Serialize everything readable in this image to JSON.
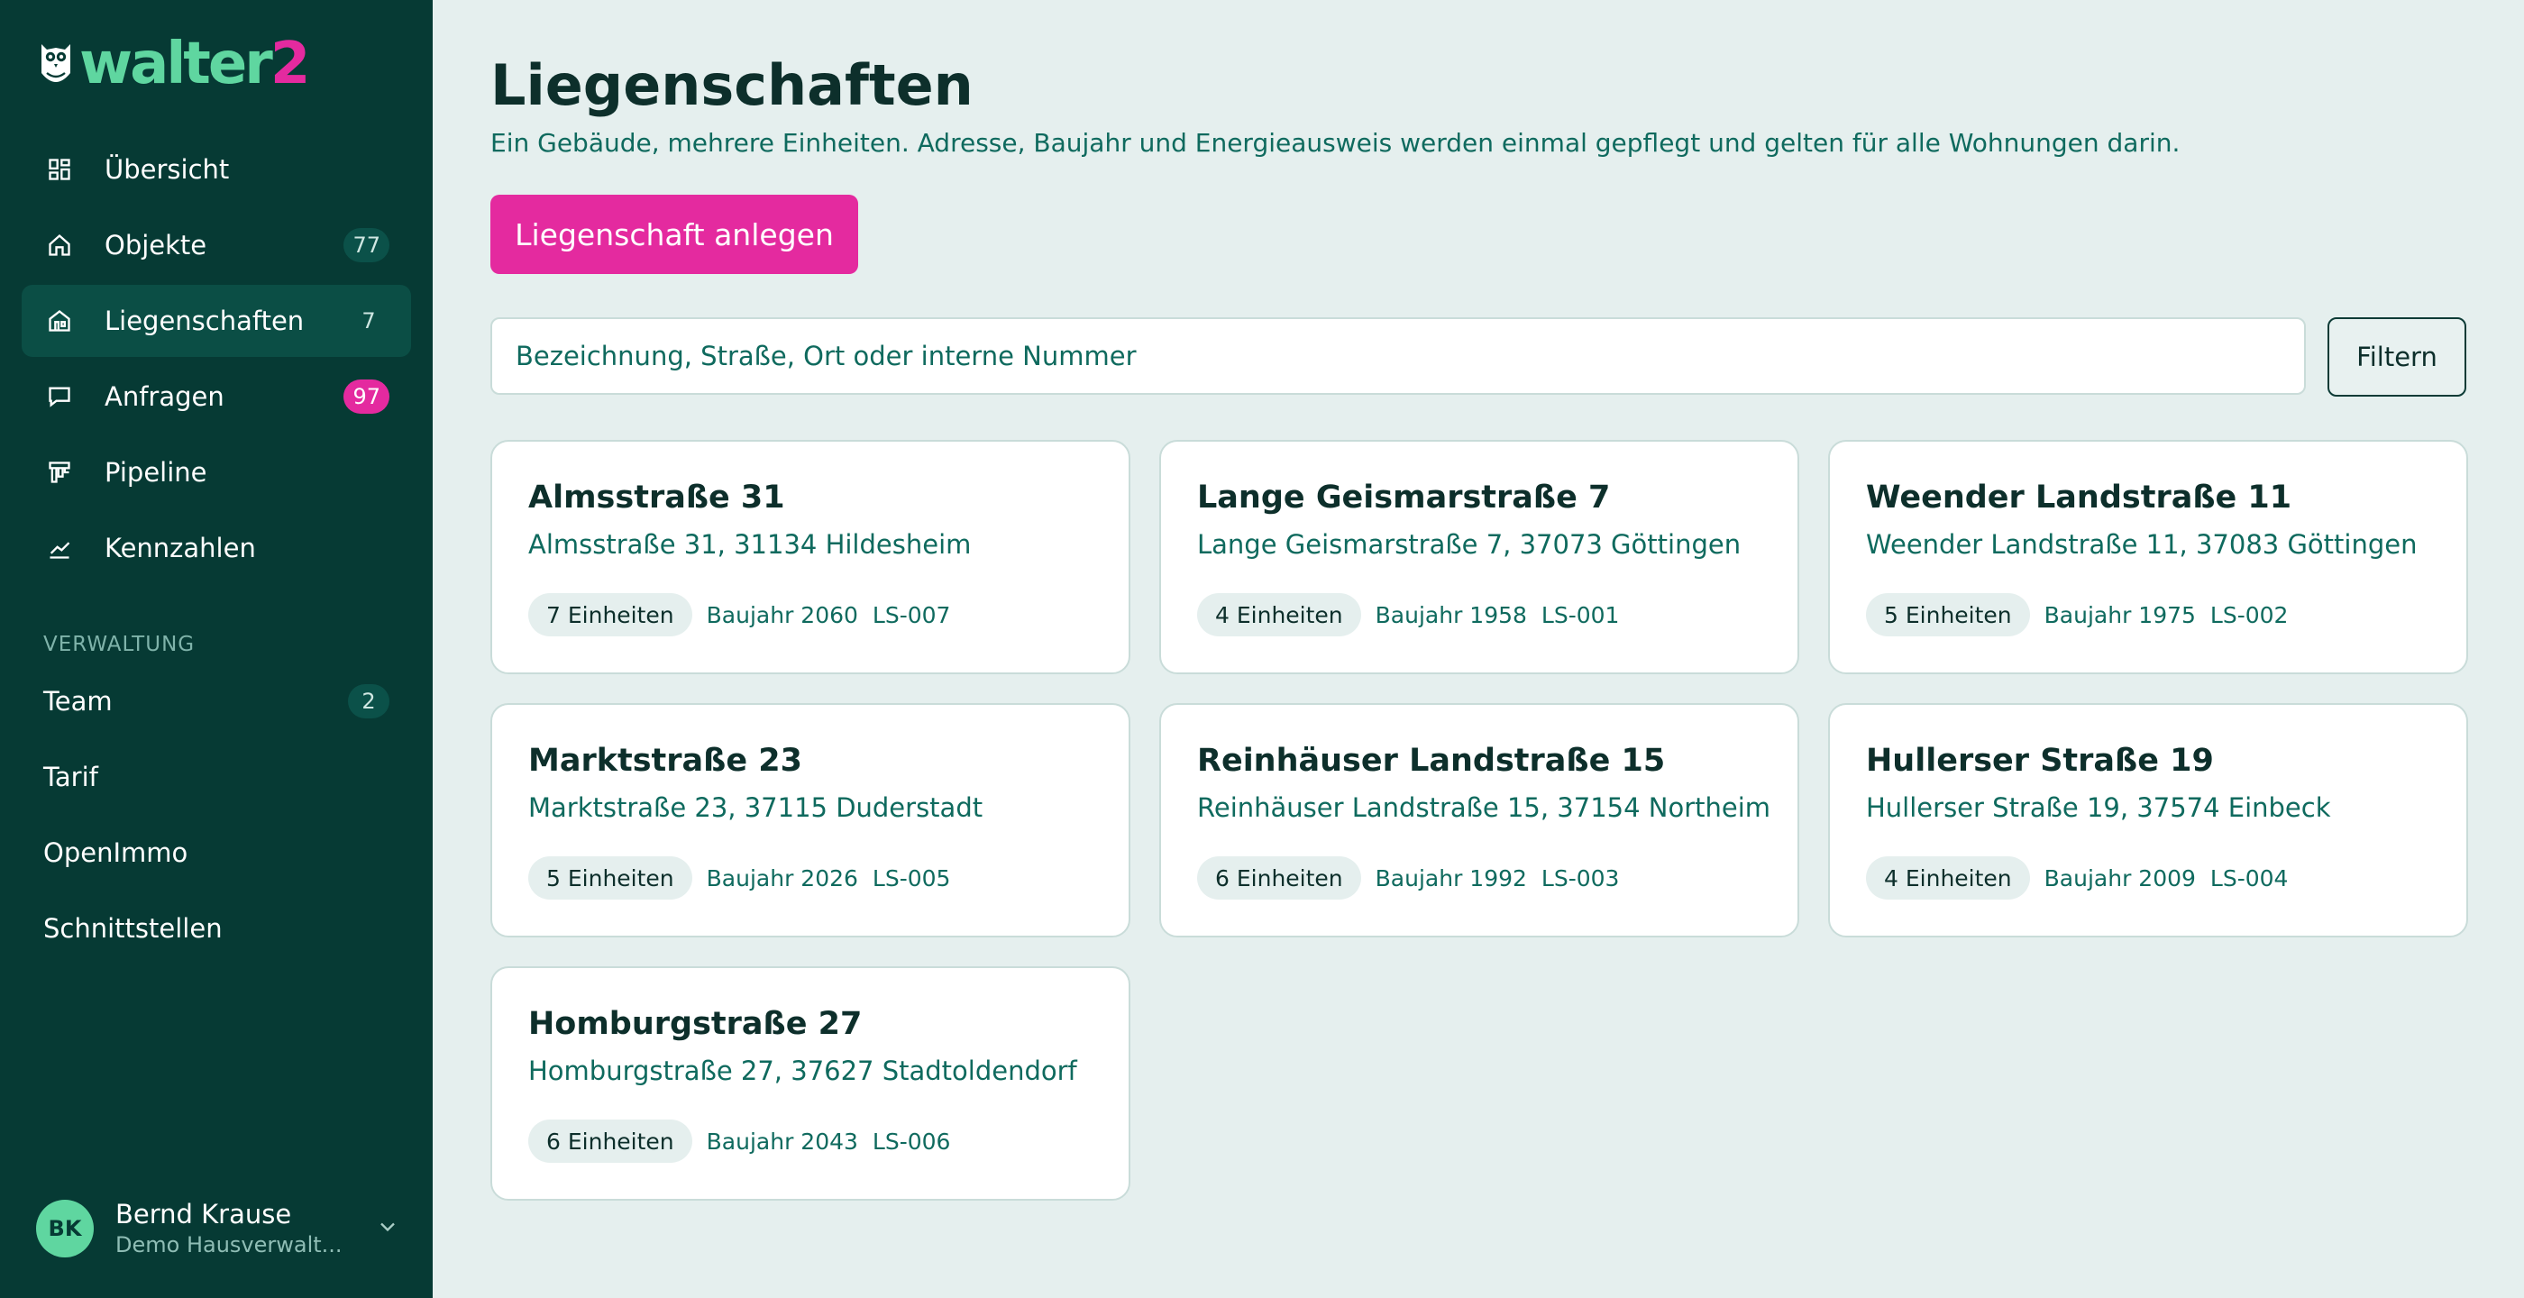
{
  "brand": {
    "name_main": "walter",
    "name_accent": "2"
  },
  "sidebar": {
    "items": [
      {
        "label": "Übersicht",
        "icon": "dashboard-icon",
        "badge": null
      },
      {
        "label": "Objekte",
        "icon": "home-icon",
        "badge": "77"
      },
      {
        "label": "Liegenschaften",
        "icon": "building-icon",
        "badge": "7",
        "active": true
      },
      {
        "label": "Anfragen",
        "icon": "chat-icon",
        "badge": "97"
      },
      {
        "label": "Pipeline",
        "icon": "pipeline-icon",
        "badge": null
      },
      {
        "label": "Kennzahlen",
        "icon": "chart-icon",
        "badge": null
      }
    ],
    "section_title": "VERWALTUNG",
    "admin_items": [
      {
        "label": "Team",
        "badge": "2"
      },
      {
        "label": "Tarif"
      },
      {
        "label": "OpenImmo"
      },
      {
        "label": "Schnittstellen"
      }
    ]
  },
  "user": {
    "initials": "BK",
    "name": "Bernd Krause",
    "org": "Demo Hausverwalt..."
  },
  "main": {
    "title": "Liegenschaften",
    "subtitle": "Ein Gebäude, mehrere Einheiten. Adresse, Baujahr und Energieausweis werden einmal gepflegt und gelten für alle Wohnungen darin.",
    "create_button": "Liegenschaft anlegen",
    "search_placeholder": "Bezeichnung, Straße, Ort oder interne Nummer",
    "filter_button": "Filtern",
    "cards": [
      {
        "title": "Almsstraße 31",
        "address": "Almsstraße 31, 31134 Hildesheim",
        "units": "7 Einheiten",
        "year": "Baujahr 2060",
        "code": "LS-007"
      },
      {
        "title": "Lange Geismarstraße 7",
        "address": "Lange Geismarstraße 7, 37073 Göttingen",
        "units": "4 Einheiten",
        "year": "Baujahr 1958",
        "code": "LS-001"
      },
      {
        "title": "Weender Landstraße 11",
        "address": "Weender Landstraße 11, 37083 Göttingen",
        "units": "5 Einheiten",
        "year": "Baujahr 1975",
        "code": "LS-002"
      },
      {
        "title": "Marktstraße 23",
        "address": "Marktstraße 23, 37115 Duderstadt",
        "units": "5 Einheiten",
        "year": "Baujahr 2026",
        "code": "LS-005"
      },
      {
        "title": "Reinhäuser Landstraße 15",
        "address": "Reinhäuser Landstraße 15, 37154 Northeim",
        "units": "6 Einheiten",
        "year": "Baujahr 1992",
        "code": "LS-003"
      },
      {
        "title": "Hullerser Straße 19",
        "address": "Hullerser Straße 19, 37574 Einbeck",
        "units": "4 Einheiten",
        "year": "Baujahr 2009",
        "code": "LS-004"
      },
      {
        "title": "Homburgstraße 27",
        "address": "Homburgstraße 27, 37627 Stadtoldendorf",
        "units": "6 Einheiten",
        "year": "Baujahr 2043",
        "code": "LS-006"
      }
    ]
  },
  "colors": {
    "sidebar": "#063a34",
    "accent": "#e42a9f",
    "brand_green": "#5fd6a0",
    "background": "#e5efee"
  }
}
